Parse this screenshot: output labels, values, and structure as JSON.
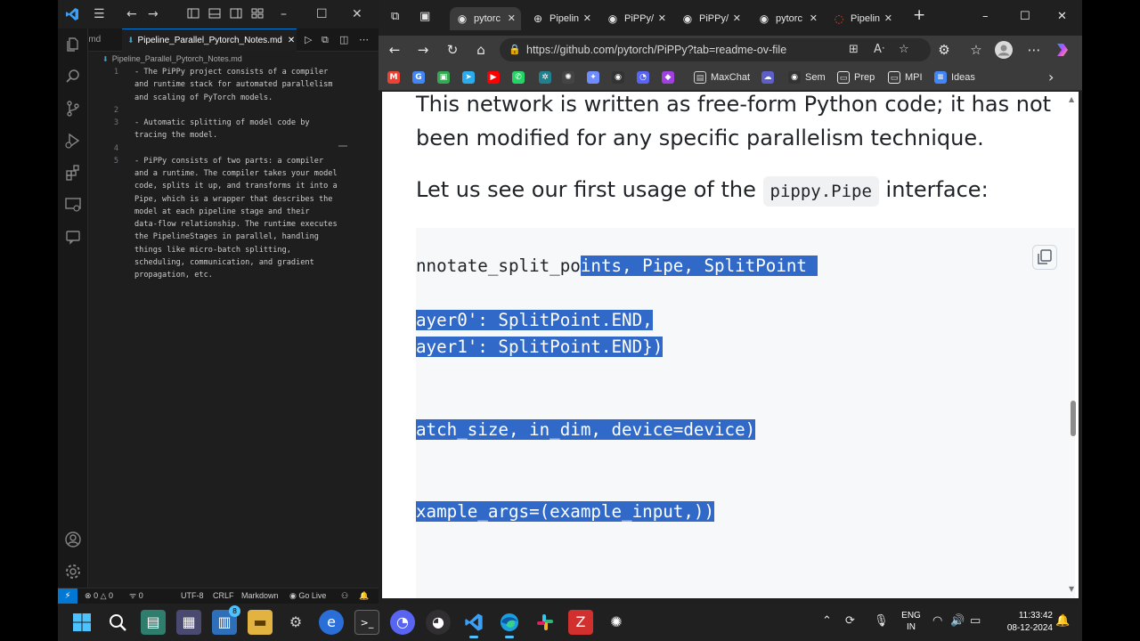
{
  "vscode": {
    "tabs": [
      {
        "label": "a.md"
      },
      {
        "label": "Pipeline_Parallel_Pytorch_Notes.md",
        "active": true
      }
    ],
    "breadcrumb": "Pipeline_Parallel_Pytorch_Notes.md",
    "editor_lines": [
      {
        "num": "1",
        "text": "- The PiPPy project consists of a compiler"
      },
      {
        "num": "",
        "text": "and runtime stack for automated parallelism"
      },
      {
        "num": "",
        "text": "and scaling of PyTorch models."
      },
      {
        "num": "2",
        "text": ""
      },
      {
        "num": "3",
        "text": "- Automatic splitting of model code by"
      },
      {
        "num": "",
        "text": "tracing the model."
      },
      {
        "num": "4",
        "text": ""
      },
      {
        "num": "5",
        "text": "- PiPPy consists of two parts: a compiler"
      },
      {
        "num": "",
        "text": "and a runtime. The compiler takes your model"
      },
      {
        "num": "",
        "text": "code, splits it up, and transforms it into a"
      },
      {
        "num": "",
        "text": "Pipe, which is a wrapper that describes the"
      },
      {
        "num": "",
        "text": "model at each pipeline stage and their"
      },
      {
        "num": "",
        "text": "data-flow relationship. The runtime executes"
      },
      {
        "num": "",
        "text": "the PipelineStages in parallel, handling"
      },
      {
        "num": "",
        "text": "things like micro-batch splitting,"
      },
      {
        "num": "",
        "text": "scheduling, communication, and gradient"
      },
      {
        "num": "",
        "text": "propagation, etc."
      }
    ],
    "status": {
      "errors": "0",
      "warnings": "0",
      "ports": "0",
      "encoding": "UTF-8",
      "eol": "CRLF",
      "language": "Markdown",
      "golive": "Go Live"
    }
  },
  "browser": {
    "tabs": [
      {
        "label": "pytorc",
        "active": true,
        "icon": "github-icon"
      },
      {
        "label": "Pipelin",
        "icon": "globe-icon"
      },
      {
        "label": "PiPPy/",
        "icon": "github-icon"
      },
      {
        "label": "PiPPy/",
        "icon": "github-icon"
      },
      {
        "label": "pytorc",
        "icon": "github-icon"
      },
      {
        "label": "Pipelin",
        "icon": "pytorch-icon"
      }
    ],
    "url": "https://github.com/pytorch/PiPPy?tab=readme-ov-file",
    "bookmarks": [
      {
        "label": "",
        "icon": "gmail-icon",
        "color": "#ea4335"
      },
      {
        "label": "",
        "icon": "google-icon",
        "color": "#4285f4"
      },
      {
        "label": "",
        "icon": "photos-icon",
        "color": "#34a853"
      },
      {
        "label": "",
        "icon": "telegram-icon",
        "color": "#2aabee"
      },
      {
        "label": "",
        "icon": "youtube-icon",
        "color": "#ff0000"
      },
      {
        "label": "",
        "icon": "whatsapp-icon",
        "color": "#25d366"
      },
      {
        "label": "",
        "icon": "perplexity-icon",
        "color": "#20808d"
      },
      {
        "label": "",
        "icon": "chatgpt-icon",
        "color": "#444444"
      },
      {
        "label": "",
        "icon": "gemini-icon",
        "color": "#6f8cff"
      },
      {
        "label": "",
        "icon": "github-icon",
        "color": "#333333"
      },
      {
        "label": "",
        "icon": "discord-icon",
        "color": "#5865f2"
      },
      {
        "label": "",
        "icon": "purple-app-icon",
        "color": "#a040e0"
      },
      {
        "label": "MaxChat",
        "icon": "page-icon",
        "color": "#cfcfcf"
      },
      {
        "label": "",
        "icon": "cloud-icon",
        "color": "#5b5fc7"
      },
      {
        "label": "Sem",
        "icon": "github-icon",
        "color": "#333333"
      },
      {
        "label": "Prep",
        "icon": "folder-icon",
        "color": "#e6e6e6"
      },
      {
        "label": "MPI",
        "icon": "folder-icon",
        "color": "#e6e6e6"
      },
      {
        "label": "Ideas",
        "icon": "docs-icon",
        "color": "#4285f4"
      }
    ],
    "page": {
      "prose1": "This network is written as free-form Python code; it has not been modified for any specific parallelism technique.",
      "prose2_before": "Let us see our first usage of the ",
      "prose2_code": "pippy.Pipe",
      "prose2_after": " interface:",
      "code_lines": [
        {
          "plain": "nnotate_split_po",
          "selected": "ints, Pipe, SplitPoint "
        },
        {
          "plain": "",
          "selected": "ayer0': SplitPoint.END,"
        },
        {
          "plain": "",
          "selected": "ayer1': SplitPoint.END})"
        },
        {
          "plain": "",
          "selected": "atch_size, in_dim, device=device)"
        },
        {
          "plain": "",
          "selected": "xample_args=(example_input,))"
        }
      ]
    }
  },
  "taskbar": {
    "apps": [
      "start-icon",
      "search-icon",
      "files-app-icon",
      "calculator-icon",
      "calendar-icon",
      "file-explorer-icon",
      "settings-icon",
      "edge-beta-icon",
      "terminal-icon",
      "discord-icon",
      "obs-icon",
      "vscode-icon",
      "edge-icon",
      "slack-icon",
      "zotero-icon",
      "chatgpt-icon"
    ],
    "badge": "8",
    "lang_line1": "ENG",
    "lang_line2": "IN",
    "time": "11:33:42",
    "date": "08-12-2024"
  },
  "colors": {
    "selection": "#3069c8",
    "vscode_accent": "#0078d4",
    "codeblock_bg": "#f6f8fa"
  }
}
